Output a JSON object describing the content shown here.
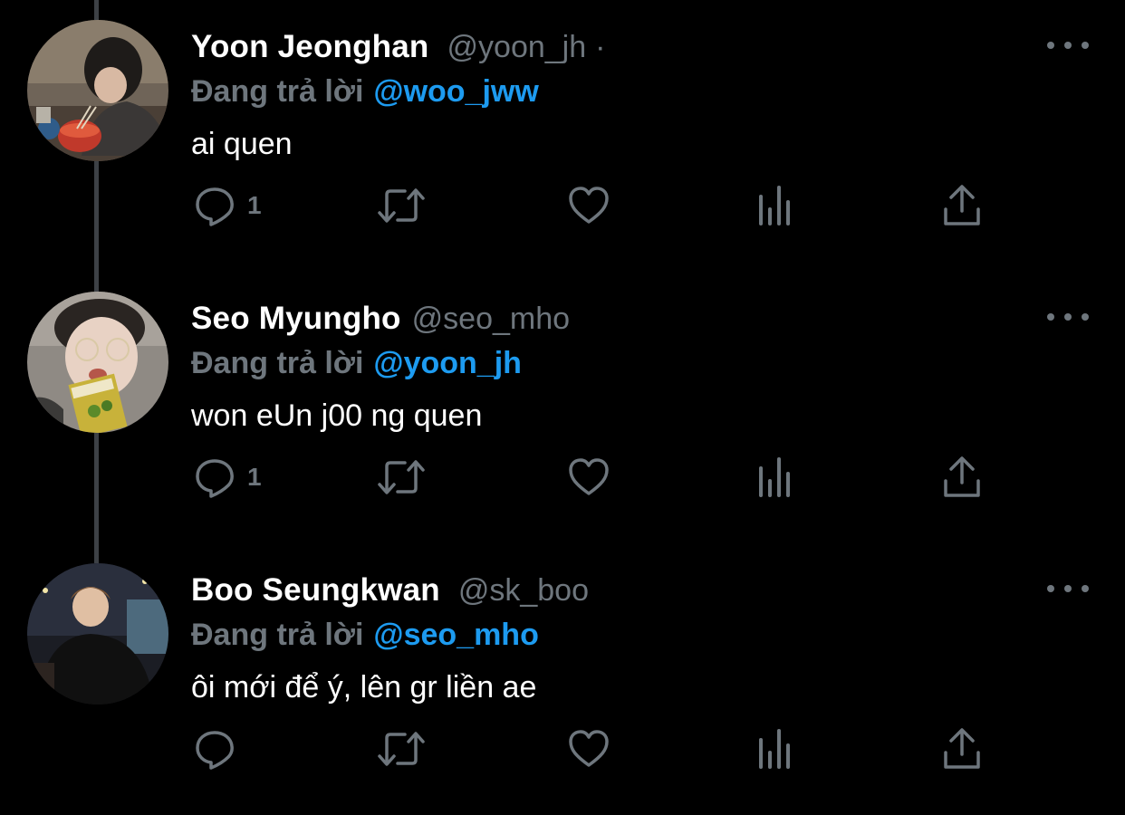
{
  "theme": {
    "background": "#000000",
    "text": "#ffffff",
    "muted": "#6e767d",
    "accent": "#1d9bf0",
    "thread_line": "#3d4146"
  },
  "icons": {
    "reply": "speech-bubble-icon",
    "retweet": "retweet-arrows-icon",
    "like": "heart-icon",
    "analytics": "bar-chart-icon",
    "share": "upload-share-icon",
    "more": "three-dots-icon"
  },
  "tweets": [
    {
      "display_name": "Yoon Jeonghan",
      "handle": "@yoon_jh",
      "separator": "·",
      "reply_label": "Đang trả lời",
      "reply_to": "@woo_jww",
      "text": "ai quen",
      "reply_count": "1"
    },
    {
      "display_name": "Seo Myungho",
      "handle": "@seo_mho",
      "separator": "",
      "reply_label": "Đang trả lời",
      "reply_to": "@yoon_jh",
      "text": "won eUn j00 ng quen",
      "reply_count": "1"
    },
    {
      "display_name": "Boo Seungkwan",
      "handle": "@sk_boo",
      "separator": "",
      "reply_label": "Đang trả lời",
      "reply_to": "@seo_mho",
      "text": "ôi mới để ý, lên gr liền ae",
      "reply_count": ""
    }
  ]
}
